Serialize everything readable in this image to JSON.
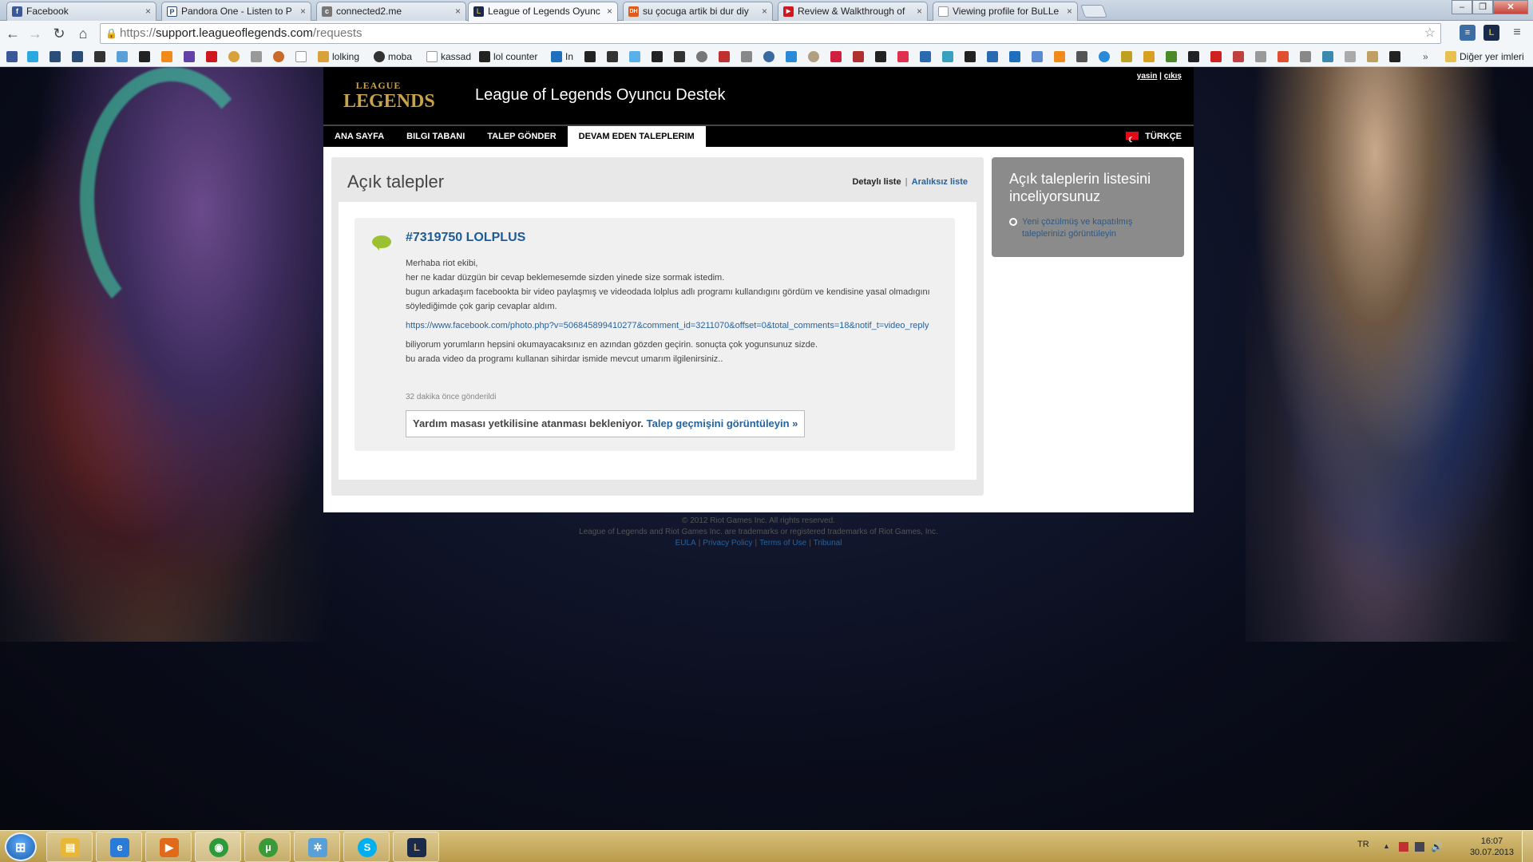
{
  "browser": {
    "tabs": [
      {
        "title": "Facebook",
        "icon": "facebook-icon",
        "color": "#3b5998",
        "glyph": "f"
      },
      {
        "title": "Pandora One - Listen to P",
        "icon": "pandora-icon",
        "color": "#ffffff",
        "glyph": "P"
      },
      {
        "title": "connected2.me",
        "icon": "connected2me-icon",
        "color": "#777777",
        "glyph": "c"
      },
      {
        "title": "League of Legends Oyunc",
        "icon": "lol-icon",
        "color": "#1a2a4a",
        "glyph": "L"
      },
      {
        "title": "su çocuga artik bi dur diy",
        "icon": "dh-icon",
        "color": "#e05a1a",
        "glyph": "DH"
      },
      {
        "title": "Review & Walkthrough of",
        "icon": "youtube-icon",
        "color": "#cc181e",
        "glyph": "▶"
      },
      {
        "title": "Viewing profile for BuLLe",
        "icon": "page-icon",
        "color": "#ffffff",
        "glyph": ""
      }
    ],
    "url_scheme": "https://",
    "url_host": "support.leagueoflegends.com",
    "url_path": "/requests",
    "bookmarks": [
      {
        "label": "lolking",
        "color": "#d9a13a"
      },
      {
        "label": "moba",
        "color": "#333333"
      },
      {
        "label": "kassad",
        "color": "#ffffff"
      },
      {
        "label": "lol counter",
        "color": "#222222"
      },
      {
        "label": "In",
        "color": "#1f6fbf"
      }
    ],
    "other_bookmarks": "Diğer yer imleri"
  },
  "site": {
    "logo_line1": "LEAGUE",
    "logo_of": "OF",
    "logo_line2": "LEGENDS",
    "title": "League of Legends Oyuncu Destek",
    "user_link": "yasin",
    "separator": "|",
    "logout_link": "çıkış",
    "nav": [
      "ANA SAYFA",
      "BILGI TABANI",
      "TALEP GÖNDER",
      "DEVAM EDEN TALEPLERIM"
    ],
    "language": "TÜRKÇE"
  },
  "main": {
    "heading": "Açık talepler",
    "view_detailed": "Detaylı liste",
    "view_separator": "|",
    "view_compact": "Aralıksız liste",
    "ticket": {
      "title": "#7319750 LOLPLUS",
      "para1": [
        "Merhaba riot ekibi,",
        "her ne kadar düzgün bir cevap beklemesemde sizden yinede size sormak istedim.",
        "bugun arkadaşım facebookta bir video paylaşmış ve videodada lolplus adlı programı kullandıgını gördüm ve kendisine yasal olmadıgını söylediğimde çok garip cevaplar aldım."
      ],
      "link": "https://www.facebook.com/photo.php?v=506845899410277&comment_id=3211070&offset=0&total_comments=18&notif_t=video_reply",
      "para2": [
        "biliyorum yorumların hepsini okumayacaksınız en azından gözden geçirin. sonuçta çok yogunsunuz sizde.",
        "bu arada video da programı kullanan sihirdar ismide mevcut umarım ilgilenirsiniz.."
      ],
      "time": "32 dakika önce gönderildi",
      "status": "Yardım masası yetkilisine atanması bekleniyor.",
      "history_link": "Talep geçmişini görüntüleyin »"
    },
    "sidebox": {
      "title": "Açık taleplerin listesini inceliyorsunuz",
      "link": "Yeni çözülmüş ve kapatılmış taleplerinizi görüntüleyin"
    }
  },
  "footer": {
    "copyright": "© 2012 Riot Games Inc. All rights reserved.",
    "trademark": "League of Legends and Riot Games Inc. are trademarks or registered trademarks of Riot Games, Inc.",
    "links": [
      "EULA",
      "Privacy Policy",
      "Terms of Use",
      "Tribunal"
    ]
  },
  "taskbar": {
    "apps": [
      {
        "name": "explorer",
        "color": "#e8b73a",
        "glyph": "▤"
      },
      {
        "name": "internet-explorer",
        "color": "#2a7ad8",
        "glyph": "e"
      },
      {
        "name": "media-player",
        "color": "#e06a1a",
        "glyph": "▶"
      },
      {
        "name": "chrome",
        "color": "#2e9a3a",
        "glyph": "◉"
      },
      {
        "name": "utorrent",
        "color": "#3a9a3a",
        "glyph": "µ"
      },
      {
        "name": "network",
        "color": "#5aa0d8",
        "glyph": "✲"
      },
      {
        "name": "skype",
        "color": "#00aff0",
        "glyph": "S"
      },
      {
        "name": "league-client",
        "color": "#1a2a4a",
        "glyph": "L"
      }
    ],
    "language": "TR",
    "time": "16:07",
    "date": "30.07.2013"
  }
}
